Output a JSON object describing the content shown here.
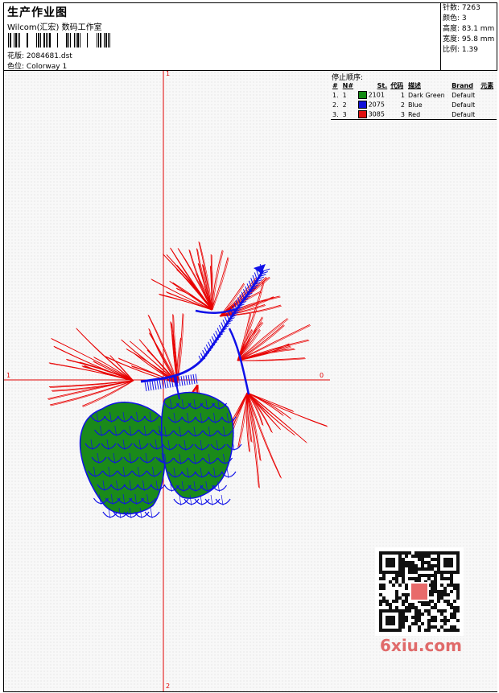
{
  "header": {
    "title": "生产作业图",
    "company": "Wilcom(汇宏) 数码工作室",
    "design_label": "花版:",
    "design_value": "2084681.dst",
    "colorway_label": "色位:",
    "colorway_value": "Colorway 1"
  },
  "stats": {
    "stitches": "针数: 7263",
    "colors": "颜色: 3",
    "height": "高度: 83.1 mm",
    "width": "宽度: 95.8 mm",
    "scale": "比例: 1.39"
  },
  "canvas": {
    "axis_top": "1",
    "axis_left": "1",
    "axis_right": "0",
    "axis_bottom": "2",
    "colors": {
      "red": "#e80000",
      "blue": "#1010e8",
      "green": "#1a8a1a"
    }
  },
  "stop_sequence": {
    "title": "停止顺序:",
    "headers": [
      "#",
      "N#",
      "St.",
      "代码",
      "描述",
      "Brand",
      "元素"
    ],
    "rows": [
      {
        "idx": "1.",
        "n": "1",
        "color": "#148a14",
        "code": "2101",
        "num": "1",
        "desc": "Dark Green",
        "brand": "Default"
      },
      {
        "idx": "2.",
        "n": "2",
        "color": "#1010d8",
        "code": "2075",
        "num": "2",
        "desc": "Blue",
        "brand": "Default"
      },
      {
        "idx": "3.",
        "n": "3",
        "color": "#e01010",
        "code": "3085",
        "num": "3",
        "desc": "Red",
        "brand": "Default"
      }
    ]
  },
  "watermark": {
    "text": "6xiu.com"
  }
}
